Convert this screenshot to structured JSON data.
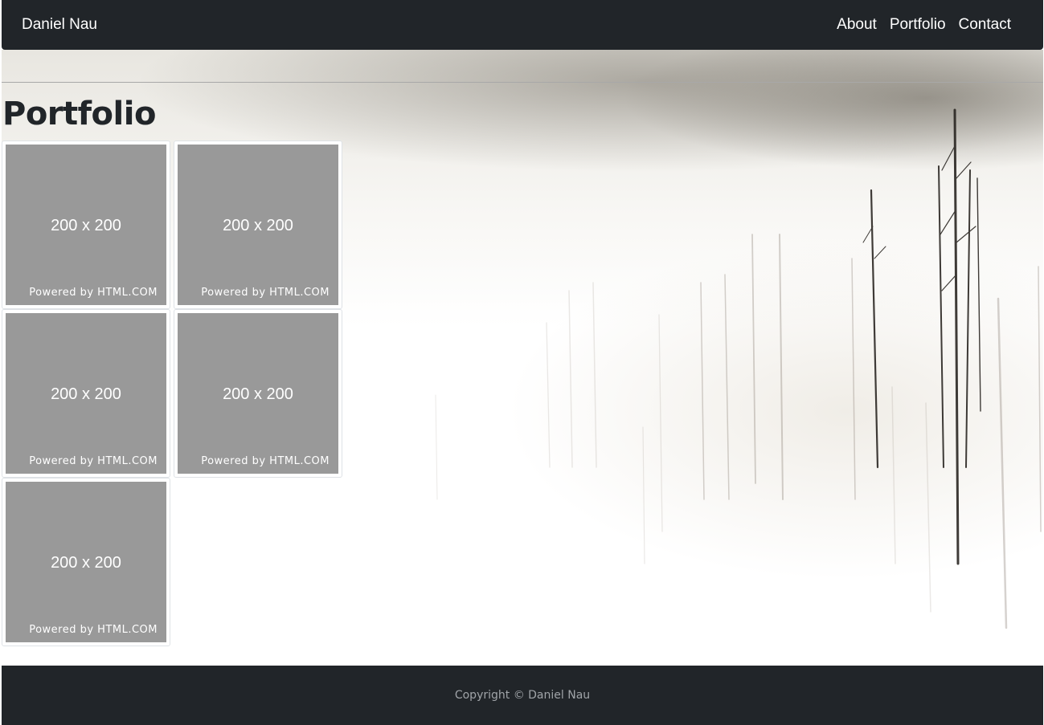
{
  "navbar": {
    "brand": "Daniel Nau",
    "links": [
      "About",
      "Portfolio",
      "Contact"
    ]
  },
  "main": {
    "title": "Portfolio",
    "thumbnails": [
      {
        "size_text": "200 x 200",
        "powered_text": "Powered by HTML.COM"
      },
      {
        "size_text": "200 x 200",
        "powered_text": "Powered by HTML.COM"
      },
      {
        "size_text": "200 x 200",
        "powered_text": "Powered by HTML.COM"
      },
      {
        "size_text": "200 x 200",
        "powered_text": "Powered by HTML.COM"
      },
      {
        "size_text": "200 x 200",
        "powered_text": "Powered by HTML.COM"
      }
    ]
  },
  "footer": {
    "copyright": "Copyright © Daniel Nau"
  },
  "colors": {
    "navbar_bg": "#212529",
    "placeholder_gray": "#999999",
    "footer_text": "#a0a4a8"
  }
}
